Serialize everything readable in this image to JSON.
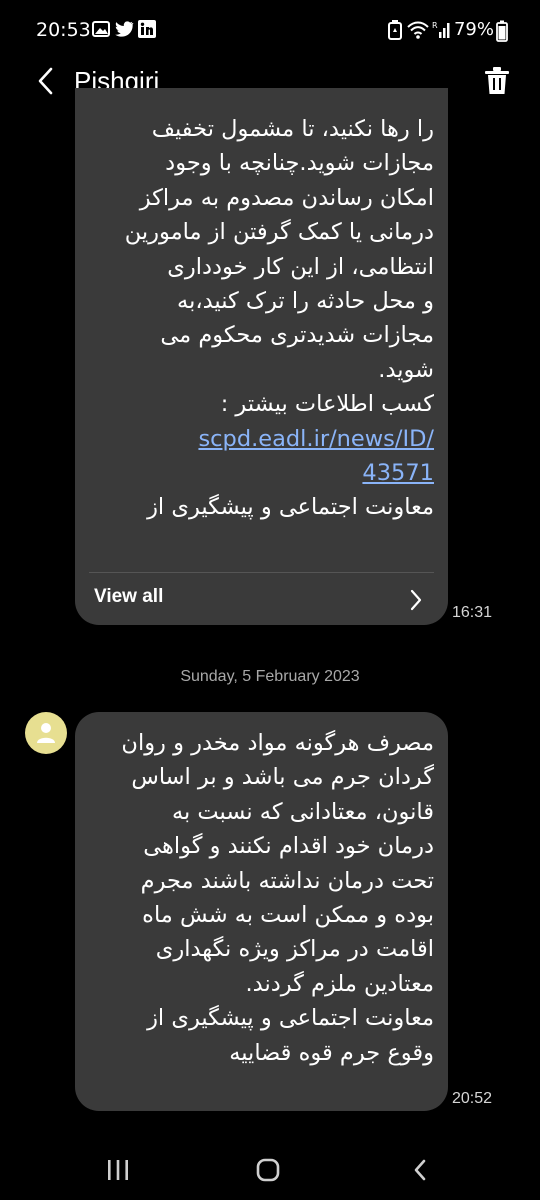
{
  "status_bar": {
    "time": "20:53",
    "battery": "79%",
    "left_icons": [
      "gallery-icon",
      "twitter-icon",
      "linkedin-icon"
    ],
    "right_icons": [
      "battery-saver-icon",
      "wifi-icon",
      "signal-icon"
    ]
  },
  "header": {
    "title": "Pishgiri",
    "back_icon": "back-arrow-icon",
    "delete_icon": "trash-icon"
  },
  "messages": [
    {
      "lines": [
        "را رها نکنید، تا مشمول تخفیف",
        "مجازات شوید.چنانچه با وجود",
        "امکان رساندن مصدوم به مراکز",
        "درمانی یا کمک گرفتن از مامورین",
        "انتظامی، از این کار خودداری",
        "و محل حادثه را ترک کنید،به",
        "مجازات شدیدتری محکوم می",
        "شوید.",
        "کسب اطلاعات بیشتر :"
      ],
      "link_lines": [
        "scpd.eadl.ir/news/ID/",
        "43571"
      ],
      "trailing_line": "معاونت اجتماعی و پیشگیری از",
      "view_all_label": "View all",
      "time": "16:31"
    },
    {
      "lines": [
        "مصرف هرگونه مواد مخدر و روان",
        "گردان جرم می باشد و بر اساس",
        "قانون، معتادانی که نسبت به",
        "درمان خود اقدام نکنند و گواهی",
        "تحت درمان نداشته باشند مجرم",
        "بوده و ممکن است به شش ماه",
        "اقامت در مراکز ویژه نگهداری",
        "معتادین ملزم گردند.",
        "معاونت اجتماعی و پیشگیری از",
        "وقوع جرم قوه قضاییه"
      ],
      "time": "20:52"
    }
  ],
  "date_separator": "Sunday, 5 February 2023",
  "colors": {
    "background": "#000000",
    "bubble": "#3a3a3a",
    "link": "#8ab4f8",
    "avatar": "#e7df91"
  },
  "nav_bar": {
    "icons": [
      "recent-apps-icon",
      "home-icon",
      "back-icon"
    ]
  }
}
